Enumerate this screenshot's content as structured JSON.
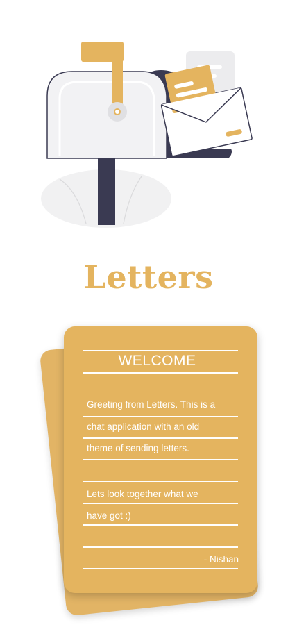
{
  "app": {
    "title": "Letters"
  },
  "letter": {
    "heading": "WELCOME",
    "lines": [
      "Greeting from Letters. This  is a",
      "chat application with an old",
      "theme of sending letters.",
      "",
      "Lets look together what we",
      "have got :)"
    ],
    "signature": "- Nishan"
  },
  "colors": {
    "accent": "#e4b45f",
    "navy": "#3a3a52",
    "white": "#ffffff"
  },
  "illustration": {
    "icon": "mailbox-with-letters-illustration"
  }
}
